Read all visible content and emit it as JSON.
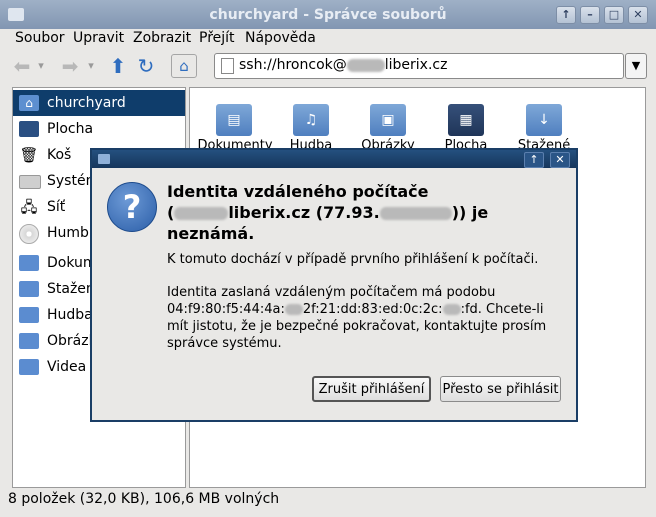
{
  "window": {
    "title": "churchyard - Správce souborů"
  },
  "menu": [
    "Soubor",
    "Upravit",
    "Zobrazit",
    "Přejít",
    "Nápověda"
  ],
  "location": {
    "value_prefix": "ssh://hroncok@",
    "value_suffix": "liberix.cz"
  },
  "sidebar": {
    "items": [
      {
        "label": "churchyard",
        "icon": "home-icon"
      },
      {
        "label": "Plocha",
        "icon": "desktop-icon"
      },
      {
        "label": "Koš",
        "icon": "trash-icon"
      },
      {
        "label": "Systém",
        "icon": "drive-icon"
      },
      {
        "label": "Síť",
        "icon": "network-icon"
      },
      {
        "label": "Humbl",
        "icon": "disc-icon"
      },
      {
        "label": "Dokum",
        "icon": "folder-icon"
      },
      {
        "label": "Stažen",
        "icon": "folder-icon"
      },
      {
        "label": "Hudba",
        "icon": "folder-icon"
      },
      {
        "label": "Obrázk",
        "icon": "folder-icon"
      },
      {
        "label": "Videa",
        "icon": "folder-icon"
      }
    ]
  },
  "content": {
    "files": [
      {
        "label": "Dokumenty",
        "glyph": "▤"
      },
      {
        "label": "Hudba",
        "glyph": "♫"
      },
      {
        "label": "Obrázky",
        "glyph": "▣"
      },
      {
        "label": "Plocha",
        "glyph": "▦"
      },
      {
        "label": "Stažené",
        "glyph": "↓"
      }
    ]
  },
  "status": {
    "text": "8 položek (32,0 KB), 106,6 MB volných"
  },
  "dialog": {
    "headline_1": "Identita vzdáleného počítače",
    "headline_2a": "(",
    "headline_2b": "liberix.cz (77.93.",
    "headline_2c": ")) je",
    "headline_3": "neznámá.",
    "message_1": "K tomuto dochází v případě prvního přihlášení k počítači.",
    "message_2a": "Identita zaslaná vzdáleným počítačem má podobu",
    "message_2b": "04:f9:80:f5:44:4a:",
    "message_2c": "2f:21:dd:83:ed:0c:2c:",
    "message_2d": ":fd. Chcete-li mít jistotu, že je bezpečné pokračovat, kontaktujte prosím správce systému.",
    "cancel_label": "Zrušit přihlášení",
    "continue_label": "Přesto se přihlásit",
    "icon": "question-icon"
  }
}
